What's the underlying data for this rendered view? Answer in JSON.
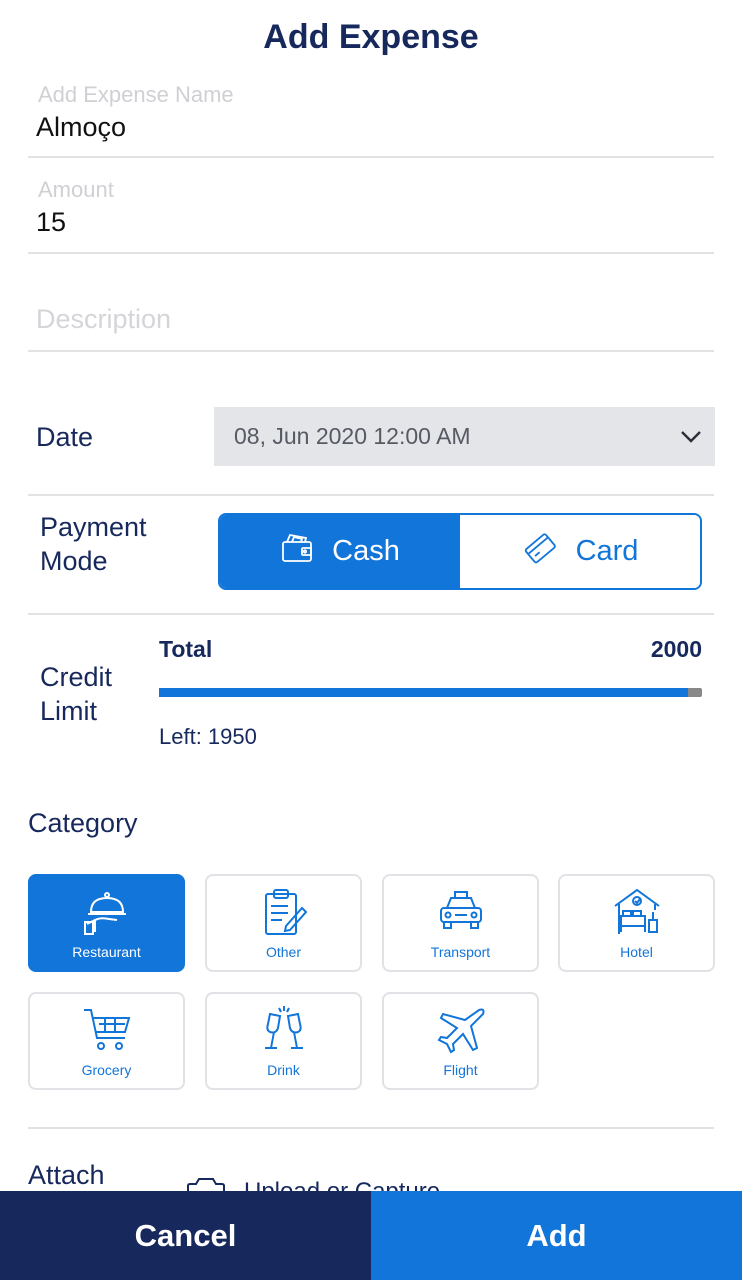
{
  "header": {
    "title": "Add Expense"
  },
  "form": {
    "name": {
      "label": "Add Expense Name",
      "value": "Almoço"
    },
    "amount": {
      "label": "Amount",
      "value": "15"
    },
    "description": {
      "placeholder": "Description"
    }
  },
  "date": {
    "label": "Date",
    "value": "08, Jun 2020 12:00 AM"
  },
  "payment": {
    "label_line1": "Payment",
    "label_line2": "Mode",
    "options": [
      {
        "label": "Cash",
        "icon": "wallet-icon",
        "selected": true
      },
      {
        "label": "Card",
        "icon": "card-icon",
        "selected": false
      }
    ]
  },
  "credit": {
    "label_line1": "Credit",
    "label_line2": "Limit",
    "total_label": "Total",
    "total_value": "2000",
    "left_text": "Left: 1950",
    "used_fraction": 0.975
  },
  "category": {
    "title": "Category",
    "items": [
      {
        "label": "Restaurant",
        "icon": "restaurant-icon",
        "selected": true
      },
      {
        "label": "Other",
        "icon": "clipboard-icon",
        "selected": false
      },
      {
        "label": "Transport",
        "icon": "taxi-icon",
        "selected": false
      },
      {
        "label": "Hotel",
        "icon": "hotel-icon",
        "selected": false
      },
      {
        "label": "Grocery",
        "icon": "cart-icon",
        "selected": false
      },
      {
        "label": "Drink",
        "icon": "drink-icon",
        "selected": false
      },
      {
        "label": "Flight",
        "icon": "plane-icon",
        "selected": false
      }
    ]
  },
  "attach": {
    "label": "Attach",
    "upload_text": "Upload or Capture"
  },
  "footer": {
    "cancel": "Cancel",
    "add": "Add"
  },
  "colors": {
    "primary": "#1175d9",
    "navy": "#17295c",
    "divider": "#e2e2e4"
  }
}
